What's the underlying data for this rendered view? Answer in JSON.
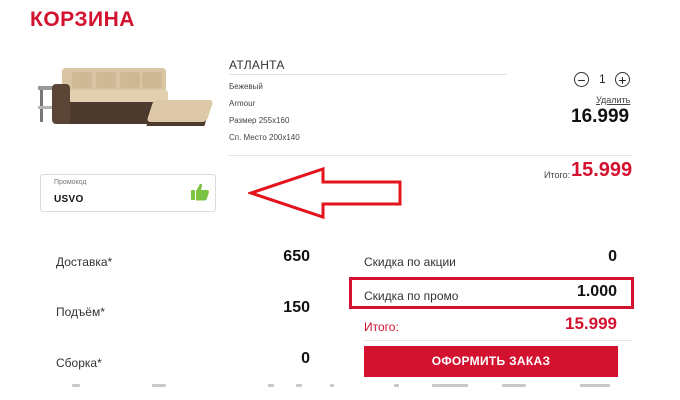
{
  "header": {
    "title": "КОРЗИНА"
  },
  "product": {
    "name": "АТЛАНТА",
    "attributes": [
      "Бежевый",
      "Armour",
      "Размер 255x160",
      "Сп. Место 200x140"
    ],
    "quantity": "1",
    "minus_symbol": "−",
    "plus_symbol": "+",
    "remove_label": "Удалить",
    "price": "16.999"
  },
  "subtotal": {
    "label": "Итого:",
    "value": "15.999"
  },
  "promo": {
    "label": "Промокод",
    "value": "USVO",
    "status_icon": "thumbs-up-icon"
  },
  "services": [
    {
      "label": "Доставка*",
      "value": "650"
    },
    {
      "label": "Подъём*",
      "value": "150"
    },
    {
      "label": "Сборка*",
      "value": "0"
    }
  ],
  "discounts": [
    {
      "label": "Скидка по акции",
      "value": "0"
    },
    {
      "label": "Скидка по промо",
      "value": "1.000"
    }
  ],
  "total": {
    "label": "Итого:",
    "value": "15.999"
  },
  "order_button": {
    "label": "ОФОРМИТЬ ЗАКАЗ"
  },
  "colors": {
    "accent": "#d3122f",
    "thumb": "#7cc242"
  }
}
